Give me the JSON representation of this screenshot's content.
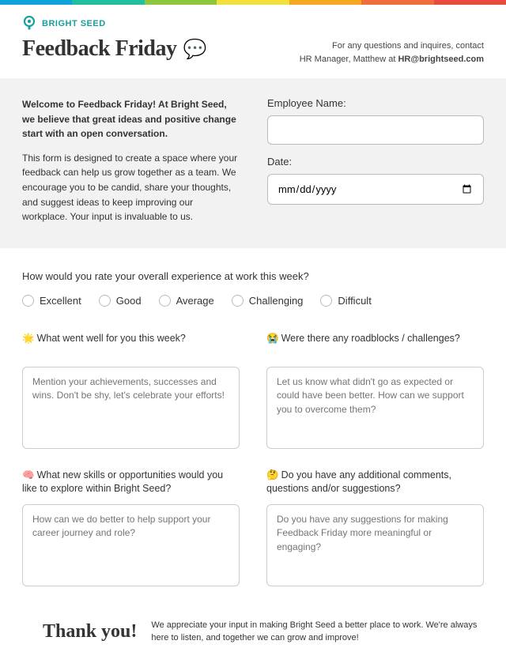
{
  "rainbow": [
    "#0fa3d9",
    "#1fbf9f",
    "#8cc63f",
    "#f3e03b",
    "#f5a623",
    "#f26d3d",
    "#e74c3c"
  ],
  "brand": {
    "name": "BRIGHT SEED"
  },
  "title": "Feedback Friday",
  "contact": {
    "line1": "For any questions and inquires, contact",
    "line2_prefix": "HR Manager, Matthew at ",
    "email": "HR@brightseed.com"
  },
  "intro": {
    "bold": "Welcome to Feedback Friday! At Bright Seed, we believe that great ideas and positive change start with an open conversation.",
    "body": "This form is designed to create a space where your feedback can help us grow together as a team. We encourage you to be candid, share your thoughts, and suggest ideas to keep improving our workplace. Your input is invaluable to us."
  },
  "fields": {
    "name_label": "Employee Name:",
    "date_label": "Date:",
    "date_placeholder": "mm/dd/yyyy"
  },
  "rating": {
    "question": "How would you rate your overall experience at work this week?",
    "options": [
      "Excellent",
      "Good",
      "Average",
      "Challenging",
      "Difficult"
    ]
  },
  "q1": {
    "emoji": "🌟",
    "text": "What went well for you this week?",
    "placeholder": "Mention your achievements, successes and wins. Don't be shy, let's celebrate your efforts!"
  },
  "q2": {
    "emoji": "😭",
    "text": "Were there any roadblocks / challenges?",
    "placeholder": "Let us know what didn't go as expected or could have been better. How can we support you to overcome them?"
  },
  "q3": {
    "emoji": "🧠",
    "text": "What new skills or opportunities would you like to explore within Bright Seed?",
    "placeholder": "How can we do better to help support your career journey and role?"
  },
  "q4": {
    "emoji": "🤔",
    "text": "Do you have any additional comments, questions and/or suggestions?",
    "placeholder": "Do you have any suggestions for making Feedback Friday more meaningful or engaging?"
  },
  "footer": {
    "thanks": "Thank you!",
    "text": "We appreciate your input in making Bright Seed a better place to work. We're always here to listen, and together we can grow and improve!"
  }
}
